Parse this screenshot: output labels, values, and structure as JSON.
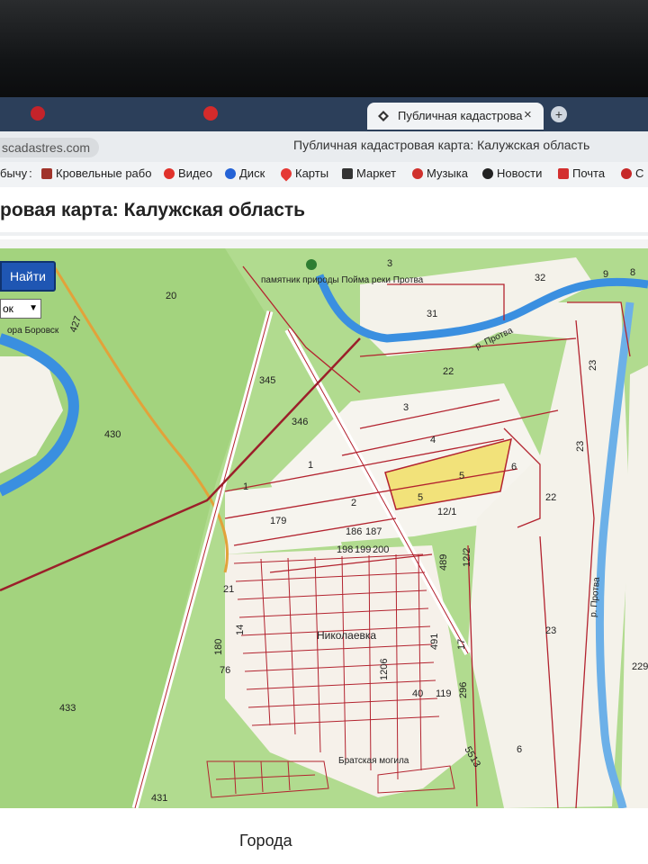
{
  "browser": {
    "tab_title": "Публичная кадастрова",
    "tab_close": "×",
    "new_tab": "+",
    "url": "scadastres.com",
    "window_title": "Публичная кадастровая карта: Калужская область",
    "colors": {
      "tabbar": "#2c3f5a",
      "accent": "#1f56b3"
    }
  },
  "bookmarks": {
    "items": [
      {
        "label": "бычу",
        "icon": "folder-icon"
      },
      {
        "label": "Кровельные рабо",
        "icon": "site-icon"
      },
      {
        "label": "Видео",
        "icon": "video-icon"
      },
      {
        "label": "Диск",
        "icon": "disk-icon"
      },
      {
        "label": "Карты",
        "icon": "map-pin-icon"
      },
      {
        "label": "Маркет",
        "icon": "market-icon"
      },
      {
        "label": "Музыка",
        "icon": "music-icon"
      },
      {
        "label": "Новости",
        "icon": "news-icon"
      },
      {
        "label": "Почта",
        "icon": "mail-icon"
      },
      {
        "label": "С",
        "icon": "site-icon"
      }
    ]
  },
  "page": {
    "heading": "ровая карта: Калужская область",
    "find_button": "Найти",
    "select_value": "ок",
    "bottom_label": "Города"
  },
  "map": {
    "labels": {
      "monument": "памятник природы Пойма реки Протва",
      "river1": "р. Протва",
      "river2": "р. Протва",
      "town": "Николаевка",
      "grave": "Братская могила",
      "road": "ора Боровск",
      "p20": "20",
      "p32": "32",
      "p31": "31",
      "p22a": "22",
      "p23a": "23",
      "p23b": "23",
      "p23c": "23",
      "p345": "345",
      "p346": "346",
      "p3": "3",
      "p4": "4",
      "p5a": "5",
      "p5b": "5",
      "p6": "6",
      "p22b": "22",
      "p1a": "1",
      "p1b": "1",
      "p2": "2",
      "p121": "12/1",
      "p179": "179",
      "p186": "186",
      "p187": "187",
      "p198": "198",
      "p199": "199",
      "p200": "200",
      "p489": "489",
      "p122": "12/2",
      "p21": "21",
      "p430": "430",
      "p433": "433",
      "p431": "431",
      "p14": "14",
      "p180": "180",
      "p76": "76",
      "p1206": "1206",
      "p40": "40",
      "p119": "119",
      "p491": "491",
      "p17": "17",
      "p296": "296",
      "p5513": "5513",
      "p6b": "6",
      "p229": "229",
      "p427": "427",
      "p9": "9",
      "p3t": "3",
      "p8": "8"
    },
    "colors": {
      "forest": "#a9d788",
      "field": "#f7f5ef",
      "highlight": "#f2e27a",
      "water": "#3a8fe0",
      "boundary": "#b3232f",
      "road": "#e2a23a"
    }
  }
}
